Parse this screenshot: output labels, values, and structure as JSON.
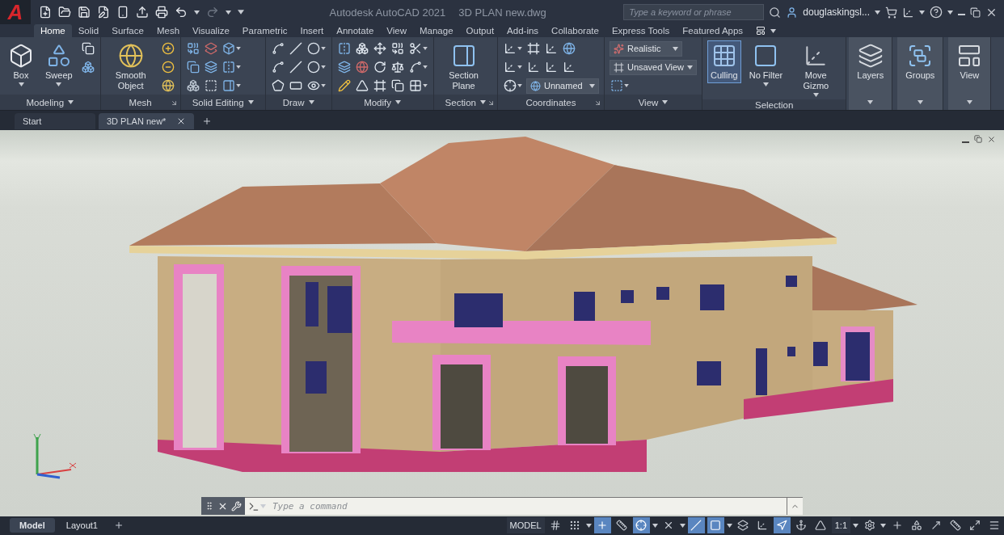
{
  "title_bar": {
    "logo": "A",
    "app_title": "Autodesk AutoCAD 2021",
    "file_name": "3D PLAN new.dwg",
    "search": {
      "placeholder": "Type a keyword or phrase"
    },
    "user": "douglaskingsl..."
  },
  "ribbon": {
    "tabs": [
      {
        "label": "Home",
        "selected": true
      },
      {
        "label": "Solid",
        "selected": false
      },
      {
        "label": "Surface",
        "selected": false
      },
      {
        "label": "Mesh",
        "selected": false
      },
      {
        "label": "Visualize",
        "selected": false
      },
      {
        "label": "Parametric",
        "selected": false
      },
      {
        "label": "Insert",
        "selected": false
      },
      {
        "label": "Annotate",
        "selected": false
      },
      {
        "label": "View",
        "selected": false
      },
      {
        "label": "Manage",
        "selected": false
      },
      {
        "label": "Output",
        "selected": false
      },
      {
        "label": "Add-ins",
        "selected": false
      },
      {
        "label": "Collaborate",
        "selected": false
      },
      {
        "label": "Express Tools",
        "selected": false
      },
      {
        "label": "Featured Apps",
        "selected": false
      }
    ],
    "panels": [
      {
        "title": "Modeling",
        "menu": true,
        "launcher": false,
        "kind": "flat",
        "tools": [
          {
            "kind": "large",
            "label": "Box",
            "dropdown": true,
            "on": false
          },
          {
            "kind": "large",
            "label": "Sweep",
            "dropdown": true,
            "on": false
          },
          {
            "kind": "stack",
            "rows": [
              [
                {
                  "kind": "icon",
                  "dropdown": false
                }
              ],
              [
                {
                  "kind": "icon",
                  "dropdown": false
                }
              ]
            ]
          }
        ]
      },
      {
        "title": "Mesh",
        "menu": false,
        "launcher": true,
        "kind": "flat",
        "tools": [
          {
            "kind": "large",
            "label": "Smooth Object",
            "dropdown": false,
            "on": false
          },
          {
            "kind": "stack",
            "rows": [
              [
                {
                  "kind": "icon",
                  "dropdown": false
                }
              ],
              [
                {
                  "kind": "icon",
                  "dropdown": false
                }
              ],
              [
                {
                  "kind": "icon",
                  "dropdown": false
                }
              ]
            ]
          }
        ]
      },
      {
        "title": "Solid Editing",
        "menu": true,
        "launcher": false,
        "kind": "flat",
        "tools": [
          {
            "kind": "stack",
            "rows": [
              [
                {
                  "kind": "icon",
                  "dropdown": false
                },
                {
                  "kind": "icon",
                  "dropdown": false
                },
                {
                  "kind": "icon",
                  "dropdown": true
                }
              ],
              [
                {
                  "kind": "icon",
                  "dropdown": false
                },
                {
                  "kind": "icon",
                  "dropdown": false
                },
                {
                  "kind": "icon",
                  "dropdown": true
                }
              ],
              [
                {
                  "kind": "icon",
                  "dropdown": false
                },
                {
                  "kind": "icon",
                  "dropdown": false
                },
                {
                  "kind": "icon",
                  "dropdown": true
                }
              ]
            ]
          }
        ]
      },
      {
        "title": "Draw",
        "menu": true,
        "launcher": false,
        "kind": "flat",
        "tools": [
          {
            "kind": "stack",
            "rows": [
              [
                {
                  "kind": "icon",
                  "dropdown": false
                },
                {
                  "kind": "icon",
                  "dropdown": false
                },
                {
                  "kind": "icon",
                  "dropdown": true
                }
              ],
              [
                {
                  "kind": "icon",
                  "dropdown": false
                },
                {
                  "kind": "icon",
                  "dropdown": false
                },
                {
                  "kind": "icon",
                  "dropdown": true
                }
              ],
              [
                {
                  "kind": "icon",
                  "dropdown": false
                },
                {
                  "kind": "icon",
                  "dropdown": false
                },
                {
                  "kind": "icon",
                  "dropdown": true
                }
              ]
            ]
          }
        ]
      },
      {
        "title": "Modify",
        "menu": true,
        "launcher": false,
        "kind": "flat",
        "tools": [
          {
            "kind": "stack",
            "rows": [
              [
                {
                  "kind": "icon",
                  "dropdown": false
                },
                {
                  "kind": "icon",
                  "dropdown": false
                },
                {
                  "kind": "icon",
                  "dropdown": false
                },
                {
                  "kind": "icon",
                  "dropdown": false
                },
                {
                  "kind": "icon",
                  "dropdown": true
                }
              ],
              [
                {
                  "kind": "icon",
                  "dropdown": false
                },
                {
                  "kind": "icon",
                  "dropdown": false
                },
                {
                  "kind": "icon",
                  "dropdown": false
                },
                {
                  "kind": "icon",
                  "dropdown": false
                },
                {
                  "kind": "icon",
                  "dropdown": true
                }
              ],
              [
                {
                  "kind": "icon",
                  "dropdown": false
                },
                {
                  "kind": "icon",
                  "dropdown": false
                },
                {
                  "kind": "icon",
                  "dropdown": false
                },
                {
                  "kind": "icon",
                  "dropdown": false
                },
                {
                  "kind": "icon",
                  "dropdown": true
                }
              ]
            ]
          }
        ]
      },
      {
        "title": "Section",
        "menu": true,
        "launcher": true,
        "kind": "flat",
        "tools": [
          {
            "kind": "large",
            "label": "Section Plane",
            "dropdown": false,
            "on": false
          }
        ]
      },
      {
        "title": "Coordinates",
        "menu": false,
        "launcher": true,
        "kind": "flat",
        "tools": [
          {
            "kind": "stack",
            "rows": [
              [
                {
                  "kind": "icon",
                  "dropdown": true
                },
                {
                  "kind": "icon",
                  "dropdown": false
                },
                {
                  "kind": "icon",
                  "dropdown": false
                },
                {
                  "kind": "icon",
                  "dropdown": false
                }
              ],
              [
                {
                  "kind": "icon",
                  "dropdown": true
                },
                {
                  "kind": "icon",
                  "dropdown": false
                },
                {
                  "kind": "icon",
                  "dropdown": false
                },
                {
                  "kind": "icon",
                  "dropdown": false
                }
              ],
              [
                {
                  "kind": "icon",
                  "dropdown": true
                },
                {
                  "kind": "combo",
                  "label": "Unnamed"
                }
              ]
            ]
          }
        ]
      },
      {
        "title": "View",
        "menu": true,
        "launcher": false,
        "kind": "flat",
        "tools": [
          {
            "kind": "stack",
            "rows": [
              [
                {
                  "kind": "combo",
                  "label": "Realistic"
                }
              ],
              [
                {
                  "kind": "combo",
                  "label": "Unsaved View"
                }
              ],
              [
                {
                  "kind": "icon",
                  "dropdown": true
                }
              ]
            ]
          }
        ]
      },
      {
        "title": "Selection",
        "menu": false,
        "launcher": false,
        "kind": "flat",
        "tools": [
          {
            "kind": "large",
            "label": "Culling",
            "dropdown": false,
            "on": true
          },
          {
            "kind": "large",
            "label": "No Filter",
            "dropdown": true,
            "on": false
          },
          {
            "kind": "large",
            "label": "Move Gizmo",
            "dropdown": true,
            "on": false
          }
        ]
      },
      {
        "menu": true,
        "launcher": false,
        "kind": "raised",
        "tools": [
          {
            "kind": "large",
            "label": "Layers",
            "dropdown": false,
            "on": false
          }
        ]
      },
      {
        "menu": true,
        "launcher": false,
        "kind": "raised",
        "tools": [
          {
            "kind": "large",
            "label": "Groups",
            "dropdown": false,
            "on": false
          }
        ]
      },
      {
        "menu": true,
        "launcher": false,
        "kind": "raised",
        "tools": [
          {
            "kind": "large",
            "label": "View",
            "dropdown": false,
            "on": false
          }
        ]
      }
    ]
  },
  "file_tabs": [
    {
      "label": "Start",
      "selected": false,
      "closable": false
    },
    {
      "label": "3D PLAN new*",
      "selected": true,
      "closable": true
    }
  ],
  "command_line": {
    "placeholder": "Type a command"
  },
  "layout_tabs": [
    {
      "label": "Model",
      "selected": true
    },
    {
      "label": "Layout1",
      "selected": false
    }
  ],
  "status_bar": [
    {
      "kind": "label",
      "text": "MODEL"
    },
    {
      "kind": "toggle",
      "on": false
    },
    {
      "kind": "toggle",
      "on": false
    },
    {
      "kind": "caret"
    },
    {
      "kind": "toggle",
      "on": true
    },
    {
      "kind": "toggle",
      "on": false
    },
    {
      "kind": "toggle",
      "on": true
    },
    {
      "kind": "caret"
    },
    {
      "kind": "toggle",
      "on": false
    },
    {
      "kind": "caret"
    },
    {
      "kind": "toggle",
      "on": true
    },
    {
      "kind": "toggle",
      "on": true
    },
    {
      "kind": "caret"
    },
    {
      "kind": "toggle",
      "on": false
    },
    {
      "kind": "toggle",
      "on": false
    },
    {
      "kind": "toggle",
      "on": true
    },
    {
      "kind": "toggle",
      "on": false
    },
    {
      "kind": "toggle",
      "on": false
    },
    {
      "kind": "label",
      "text": "1:1"
    },
    {
      "kind": "caret"
    },
    {
      "kind": "toggle",
      "on": false
    },
    {
      "kind": "caret"
    },
    {
      "kind": "toggle",
      "on": false
    },
    {
      "kind": "toggle",
      "on": false
    },
    {
      "kind": "toggle",
      "on": false
    },
    {
      "kind": "toggle",
      "on": false
    },
    {
      "kind": "toggle",
      "on": false
    },
    {
      "kind": "toggle",
      "on": false
    }
  ]
}
